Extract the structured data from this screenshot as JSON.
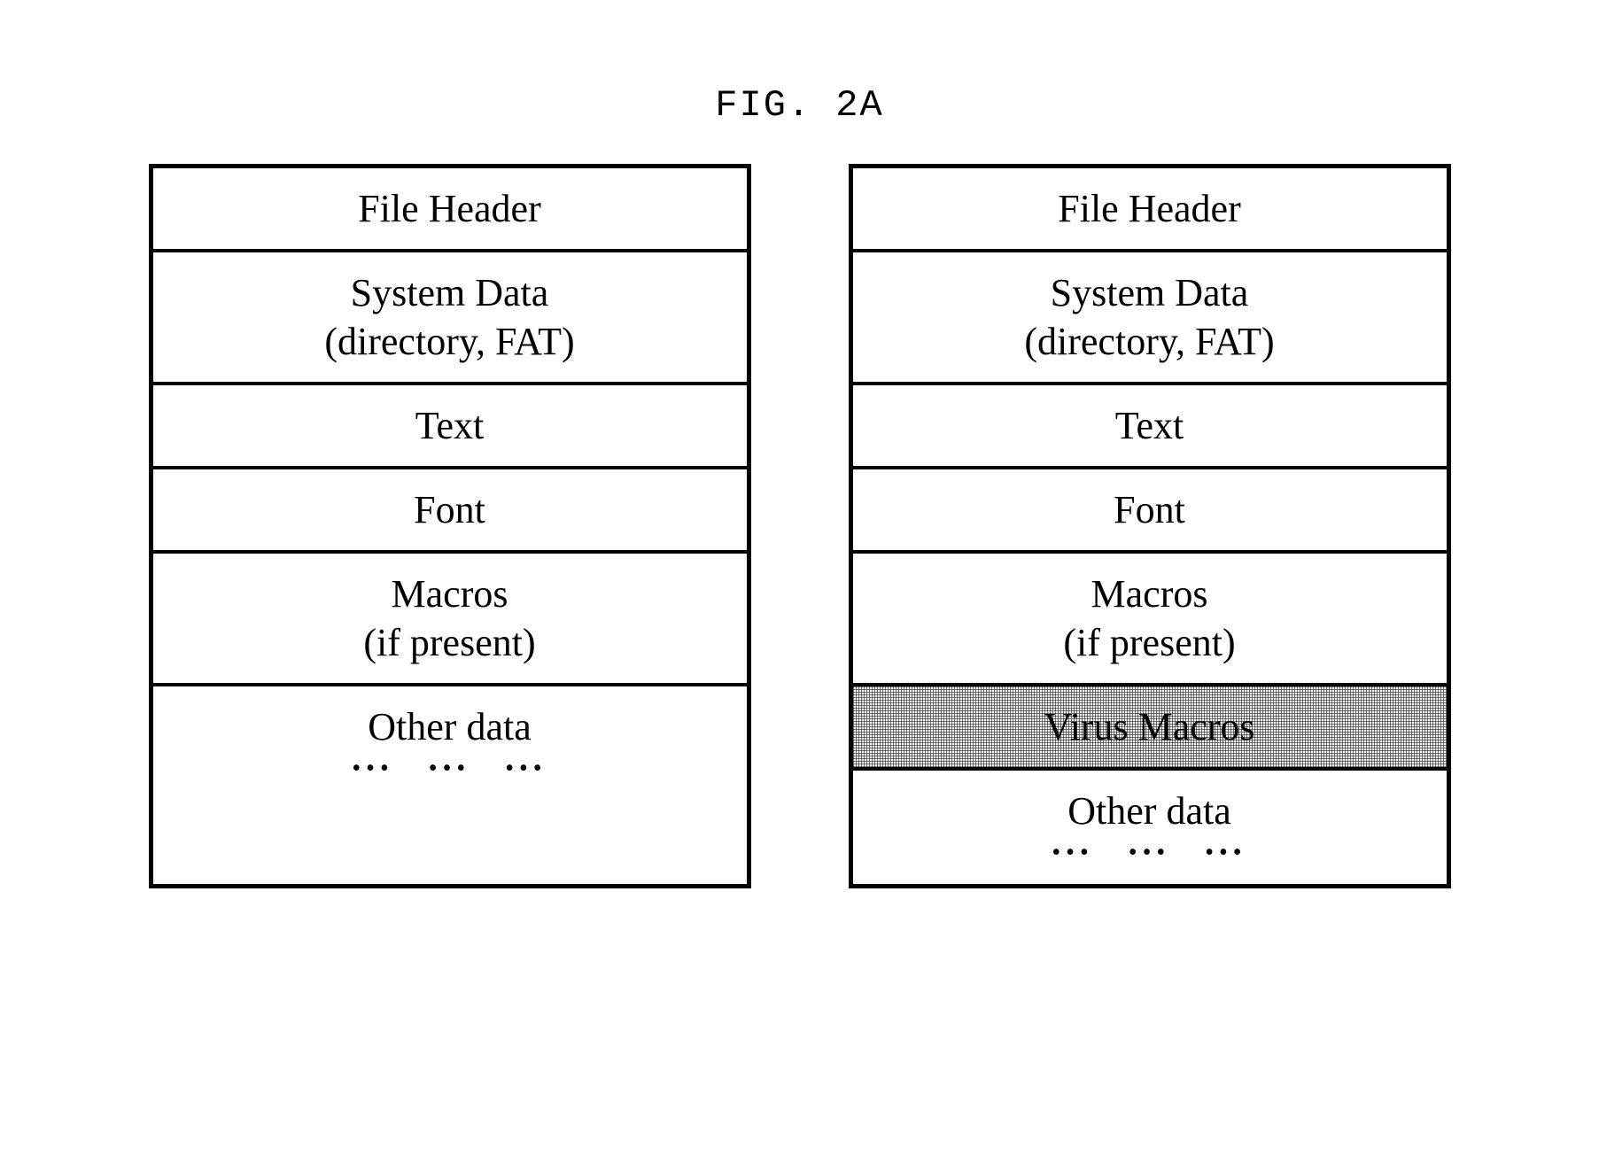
{
  "figure_title": "FIG. 2A",
  "left_table": {
    "rows": [
      {
        "l1": "File Header",
        "l2": ""
      },
      {
        "l1": "System Data",
        "l2": "(directory, FAT)"
      },
      {
        "l1": "Text",
        "l2": ""
      },
      {
        "l1": "Font",
        "l2": ""
      },
      {
        "l1": "Macros",
        "l2": "(if present)"
      },
      {
        "l1": "Other data",
        "l2": "..."
      }
    ]
  },
  "right_table": {
    "rows": [
      {
        "l1": "File Header",
        "l2": ""
      },
      {
        "l1": "System Data",
        "l2": "(directory, FAT)"
      },
      {
        "l1": "Text",
        "l2": ""
      },
      {
        "l1": "Font",
        "l2": ""
      },
      {
        "l1": "Macros",
        "l2": "(if present)"
      },
      {
        "l1": "Virus Macros",
        "l2": "",
        "shaded": true
      },
      {
        "l1": "Other data",
        "l2": "..."
      }
    ]
  },
  "dots": "•••   •••   •••"
}
